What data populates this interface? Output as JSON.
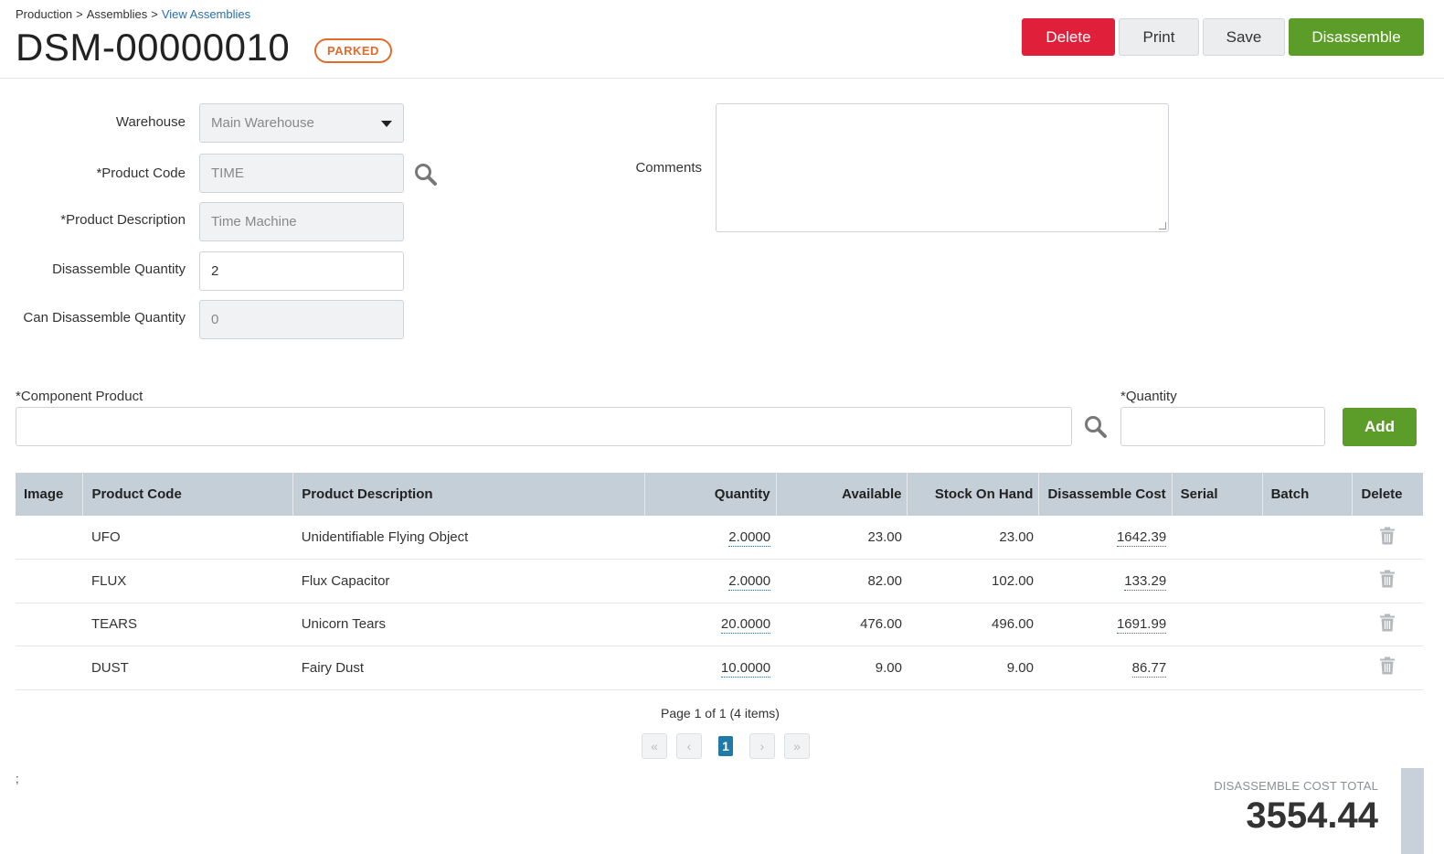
{
  "breadcrumb": {
    "item1": "Production",
    "item2": "Assemblies",
    "item3": "View Assemblies",
    "separator": ">"
  },
  "header": {
    "title": "DSM-00000010",
    "status": "PARKED"
  },
  "toolbar": {
    "delete_label": "Delete",
    "print_label": "Print",
    "save_label": "Save",
    "disassemble_label": "Disassemble"
  },
  "form": {
    "warehouse_label": "Warehouse",
    "warehouse_value": "Main Warehouse",
    "product_code_label": "*Product Code",
    "product_code_value": "TIME",
    "product_description_label": "*Product Description",
    "product_description_value": "Time Machine",
    "disassemble_qty_label": "Disassemble Quantity",
    "disassemble_qty_value": "2",
    "can_disassemble_qty_label": "Can Disassemble Quantity",
    "can_disassemble_qty_value": "0",
    "comments_label": "Comments",
    "comments_value": ""
  },
  "component": {
    "product_label": "*Component Product",
    "product_value": "",
    "quantity_label": "*Quantity",
    "quantity_value": "",
    "add_label": "Add"
  },
  "table": {
    "headers": {
      "image": "Image",
      "code": "Product Code",
      "description": "Product Description",
      "quantity": "Quantity",
      "available": "Available",
      "stock": "Stock On Hand",
      "cost": "Disassemble Cost",
      "serial": "Serial",
      "batch": "Batch",
      "delete": "Delete"
    },
    "rows": [
      {
        "code": "UFO",
        "description": "Unidentifiable Flying Object",
        "quantity": "2.0000",
        "available": "23.00",
        "stock": "23.00",
        "cost": "1642.39"
      },
      {
        "code": "FLUX",
        "description": "Flux Capacitor",
        "quantity": "2.0000",
        "available": "82.00",
        "stock": "102.00",
        "cost": "133.29"
      },
      {
        "code": "TEARS",
        "description": "Unicorn Tears",
        "quantity": "20.0000",
        "available": "476.00",
        "stock": "496.00",
        "cost": "1691.99"
      },
      {
        "code": "DUST",
        "description": "Fairy Dust",
        "quantity": "10.0000",
        "available": "9.00",
        "stock": "9.00",
        "cost": "86.77"
      }
    ]
  },
  "pager": {
    "info": "Page 1 of 1 (4 items)",
    "current": "1",
    "first": "«",
    "prev": "‹",
    "next": "›",
    "last": "»"
  },
  "stray_text": ";",
  "totals": {
    "label": "DISASSEMBLE COST TOTAL",
    "value": "3554.44"
  },
  "colors": {
    "delete": "#e0203a",
    "primary_green": "#5c9d2a",
    "status_orange": "#e46a2c",
    "header_bg": "#c5cfd8",
    "link_blue": "#2a6fb0"
  }
}
